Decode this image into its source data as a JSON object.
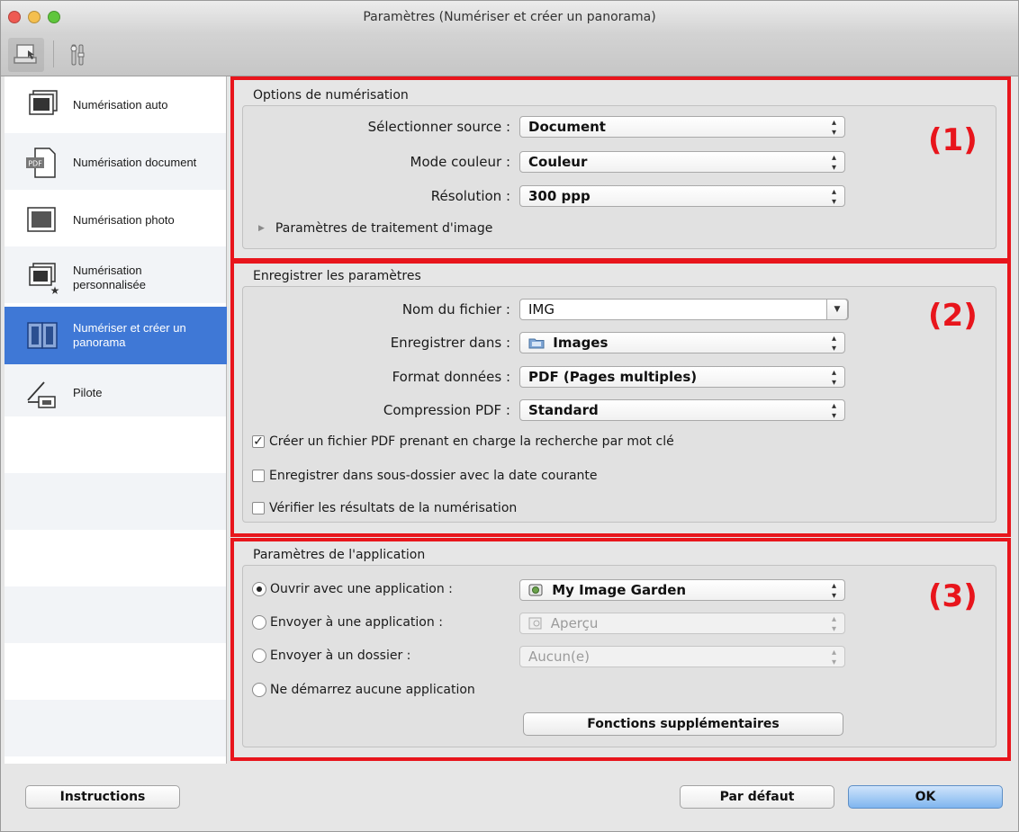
{
  "window": {
    "title": "Paramètres (Numériser et créer un panorama)"
  },
  "toolbar": {
    "icons": [
      "scan-settings-icon",
      "tools-settings-icon"
    ]
  },
  "sidebar": {
    "items": [
      {
        "label": "Numérisation auto",
        "icon": "auto-scan-icon"
      },
      {
        "label": "Numérisation document",
        "icon": "pdf-document-icon"
      },
      {
        "label": "Numérisation photo",
        "icon": "photo-icon"
      },
      {
        "label": "Numérisation personnalisée",
        "icon": "custom-scan-icon"
      },
      {
        "label": "Numériser et créer un panorama",
        "icon": "panorama-icon"
      },
      {
        "label": "Pilote",
        "icon": "driver-icon"
      }
    ],
    "selected": "Numériser et créer un panorama"
  },
  "scan_options": {
    "title": "Options de numérisation",
    "number": "(1)",
    "source_label": "Sélectionner source :",
    "source_value": "Document",
    "color_label": "Mode couleur :",
    "color_value": "Couleur",
    "resolution_label": "Résolution :",
    "resolution_value": "300 ppp",
    "image_processing": "Paramètres de traitement d'image"
  },
  "save_settings": {
    "title": "Enregistrer les paramètres",
    "number": "(2)",
    "filename_label": "Nom du fichier :",
    "filename_value": "IMG",
    "savein_label": "Enregistrer dans :",
    "savein_value": "Images",
    "format_label": "Format données :",
    "format_value": "PDF (Pages multiples)",
    "compression_label": "Compression PDF :",
    "compression_value": "Standard",
    "cb_keyword": "Créer un fichier PDF prenant en charge la recherche par mot clé",
    "cb_keyword_checked": true,
    "cb_subfolder": "Enregistrer dans sous-dossier avec la date courante",
    "cb_subfolder_checked": false,
    "cb_verify": "Vérifier les résultats de la numérisation",
    "cb_verify_checked": false
  },
  "app_settings": {
    "title": "Paramètres de l'application",
    "number": "(3)",
    "open_with_label": "Ouvrir avec une application :",
    "open_with_value": "My Image Garden",
    "send_app_label": "Envoyer à une application :",
    "send_app_value": "Aperçu",
    "send_folder_label": "Envoyer à un dossier :",
    "send_folder_value": "Aucun(e)",
    "none_label": "Ne démarrez aucune application",
    "selected": "Ouvrir avec une application :",
    "more_button": "Fonctions supplémentaires"
  },
  "footer": {
    "instructions": "Instructions",
    "defaults": "Par défaut",
    "ok": "OK"
  },
  "colors": {
    "highlight_red": "#e8151c",
    "selection_blue": "#3f78d6"
  }
}
